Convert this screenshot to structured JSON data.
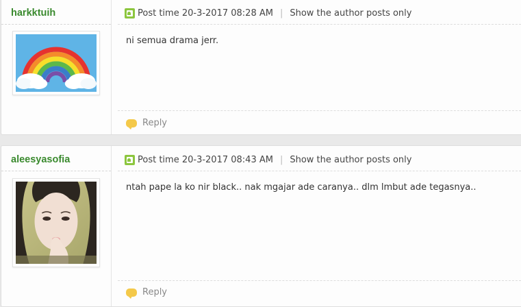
{
  "posts": [
    {
      "author": "harkktuih",
      "post_time": "Post time 20-3-2017 08:28 AM",
      "separator": "|",
      "author_only_link": "Show the author posts only",
      "message": "ni semua drama jerr.",
      "reply_label": "Reply"
    },
    {
      "author": "aleesyasofia",
      "post_time": "Post time 20-3-2017 08:43 AM",
      "separator": "|",
      "author_only_link": "Show the author posts only",
      "message": "ntah pape la ko nir black.. nak mgajar ade caranya.. dlm lmbut ade tegasnya..",
      "reply_label": "Reply"
    }
  ],
  "icons": {
    "online_status": "online-status-icon",
    "reply": "reply-bubble-icon"
  },
  "colors": {
    "author_name": "#3a8a2e",
    "online_icon": "#8cc63e",
    "reply_icon": "#f4c94a"
  }
}
